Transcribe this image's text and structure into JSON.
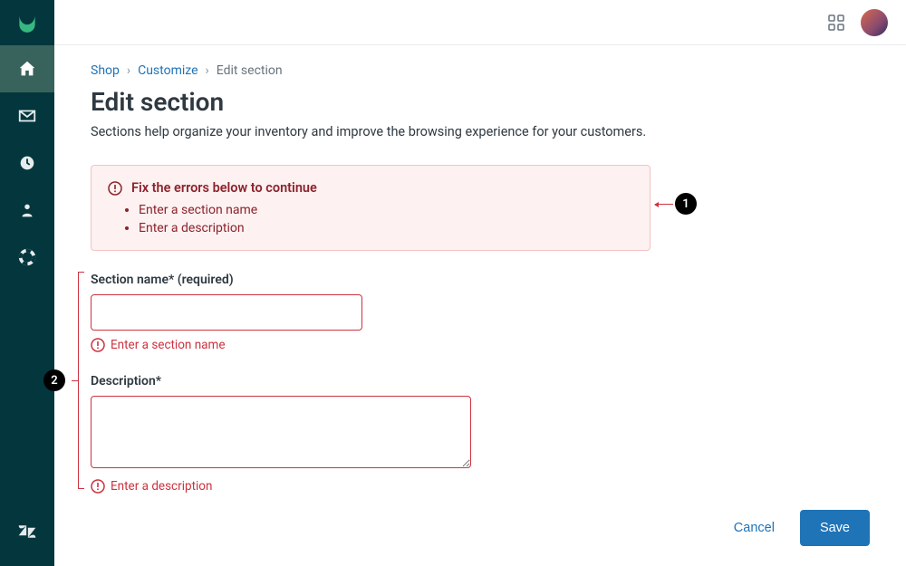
{
  "breadcrumb": {
    "shop": "Shop",
    "customize": "Customize",
    "current": "Edit section"
  },
  "page": {
    "title": "Edit section",
    "subtitle": "Sections help organize your inventory and improve the browsing experience for your customers."
  },
  "alert": {
    "title": "Fix the errors below to continue",
    "items": [
      "Enter a section name",
      "Enter a description"
    ]
  },
  "fields": {
    "name": {
      "label": "Section name* (required)",
      "value": "",
      "error": "Enter a section name"
    },
    "description": {
      "label": "Description*",
      "value": "",
      "error": "Enter a description"
    }
  },
  "actions": {
    "cancel": "Cancel",
    "save": "Save"
  },
  "markers": {
    "one": "1",
    "two": "2"
  },
  "colors": {
    "primary": "#1f73b7",
    "error": "#cc3340",
    "sidebar": "#03363d"
  }
}
